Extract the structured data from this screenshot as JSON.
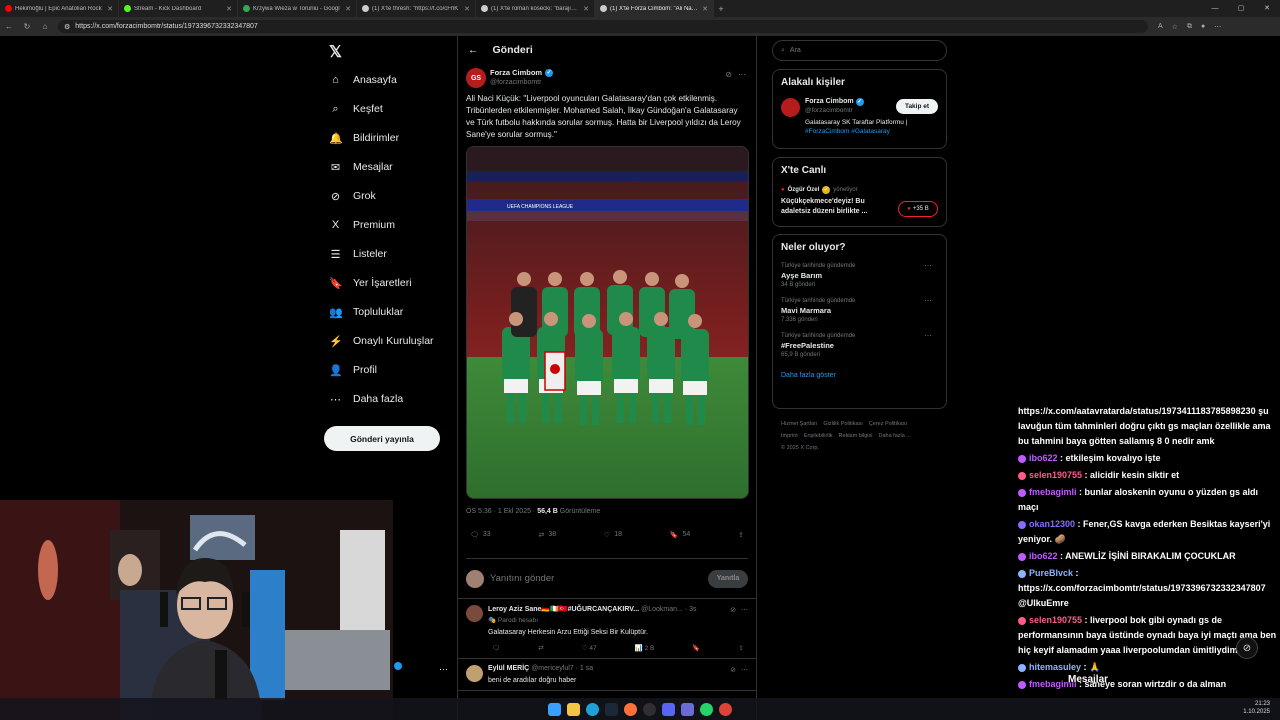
{
  "browser": {
    "tabs": [
      {
        "label": "Hekimoğlu | Epic Anatolian Rock",
        "icon": "youtube-icon",
        "color": "#ff0000"
      },
      {
        "label": "Stream - Kick Dashboard",
        "icon": "kick-icon",
        "color": "#53fc18"
      },
      {
        "label": "Krzywa Wieża w Toruniu - Googl",
        "icon": "maps-icon",
        "color": "#34a853"
      },
      {
        "label": "(1) X'te thresh: \"https://t.co/cFhK",
        "icon": "x-icon",
        "color": "#cccccc"
      },
      {
        "label": "(1) X'te roman kosecki: \"barajın al",
        "icon": "x-icon",
        "color": "#cccccc"
      },
      {
        "label": "(1) X'te Forza Cimbom: \"Ali Naci K",
        "icon": "x-icon",
        "color": "#cccccc"
      }
    ],
    "url": "https://x.com/forzacimbomtr/status/1973396732332347807"
  },
  "nav": {
    "items": [
      {
        "label": "Anasayfa",
        "icon": "home-icon",
        "glyph": "⌂"
      },
      {
        "label": "Keşfet",
        "icon": "search-icon",
        "glyph": "⌕"
      },
      {
        "label": "Bildirimler",
        "icon": "bell-icon",
        "glyph": "🔔"
      },
      {
        "label": "Mesajlar",
        "icon": "mail-icon",
        "glyph": "✉"
      },
      {
        "label": "Grok",
        "icon": "grok-icon",
        "glyph": "⊘"
      },
      {
        "label": "Premium",
        "icon": "x-premium-icon",
        "glyph": "X"
      },
      {
        "label": "Listeler",
        "icon": "list-icon",
        "glyph": "☰"
      },
      {
        "label": "Yer İşaretleri",
        "icon": "bookmark-icon",
        "glyph": "🔖"
      },
      {
        "label": "Topluluklar",
        "icon": "communities-icon",
        "glyph": "👥"
      },
      {
        "label": "Onaylı Kuruluşlar",
        "icon": "lightning-icon",
        "glyph": "⚡"
      },
      {
        "label": "Profil",
        "icon": "profile-icon",
        "glyph": "👤"
      },
      {
        "label": "Daha fazla",
        "icon": "more-circle-icon",
        "glyph": "⋯"
      }
    ],
    "post_button": "Gönderi yayınla",
    "messages_badge": "1"
  },
  "main": {
    "header": "Gönderi",
    "post": {
      "name": "Forza Cimbom",
      "handle": "@forzacimbomtr",
      "text": "Ali Naci Küçük: \"Liverpool oyuncuları Galatasaray'dan çok etkilenmiş. Tribünlerden etkilenmişler. Mohamed Salah, İlkay Gündoğan'a Galatasaray ve Türk futbolu hakkında sorular sormuş. Hatta bir Liverpool yıldızı da Leroy Sane'ye sorular sormuş.\"",
      "media_banner": "UEFA CHAMPIONS LEAGUE",
      "time": "ÖS 5:36 · 1 Ekl 2025 · ",
      "views": "56,4 B",
      "views_label": "Görüntüleme",
      "replies": "33",
      "retweets": "38",
      "likes": "18",
      "bookmarks": "54"
    },
    "reply_placeholder": "Yanıtını gönder",
    "reply_button": "Yanıtla",
    "comments": [
      {
        "name": "Leroy Aziz Sane🇩🇪🇮🇪🇹🇷#UĞURCANÇAKIRV...",
        "handle": "@Lookman...",
        "time": "· 3s",
        "tag": "Parodi hesabı",
        "text": "Galatasaray Herkesin Arzu Ettiği Seksi Bir Kulüptür.",
        "likes": "47",
        "views": "2 B"
      },
      {
        "name": "Eylül MERİÇ",
        "handle": "@mericeylul7",
        "time": "· 1 sa",
        "tag": "",
        "text": "beni de aradılar doğru haber",
        "likes": "",
        "views": ""
      }
    ]
  },
  "right": {
    "search_placeholder": "Ara",
    "related": {
      "title": "Alakalı kişiler",
      "name": "Forza Cimbom",
      "handle": "@forzacimbomtr",
      "bio": "Galatasaray SK Taraftar Platformu | ",
      "bio_tags": "#ForzaCimbom #Galatasaray",
      "follow": "Takip et"
    },
    "live": {
      "title": "X'te Canlı",
      "host": "Özgür Özel",
      "host_suffix": "yönetiyor",
      "text": "Küçükçekmece'deyiz! Bu adaletsiz düzeni birlikte ...",
      "count": "+35 B"
    },
    "trends": {
      "title": "Neler oluyor?",
      "items": [
        {
          "context": "Türkiye tarihinde gündemde",
          "name": "Ayşe Barım",
          "count": "34 B gönderi"
        },
        {
          "context": "Türkiye tarihinde gündemde",
          "name": "Mavi Marmara",
          "count": "7.336 gönderi"
        },
        {
          "context": "Türkiye tarihinde gündemde",
          "name": "#FreePalestine",
          "count": "65,9 B gönderi"
        }
      ],
      "more": "Daha fazla göster"
    },
    "footer": [
      "Hizmet Şartları",
      "Gizlilik Politikası",
      "Çerez Politikası",
      "Imprint",
      "Erişilebilirlik",
      "Reklam bilgisi",
      "Daha fazla ...",
      "© 2025 X Corp."
    ]
  },
  "chat": [
    {
      "user": "",
      "color": "#ffffff",
      "text": "https://x.com/aatavratarda/status/1973411183785898230 şu lavuğun tüm tahminleri doğru çıktı gs maçları özellikle ama bu tahmini baya götten sallamış 8 0 nedir amk"
    },
    {
      "user": "ibo622",
      "color": "#c05cff",
      "text": " : etkileşim kovalıyo işte"
    },
    {
      "user": "selen190755",
      "color": "#ff5c8a",
      "text": " : alicidir kesin siktir et"
    },
    {
      "user": "fmebagimli",
      "color": "#c05cff",
      "text": " : bunlar aloskenin oyunu o yüzden gs aldı maçı"
    },
    {
      "user": "okan12300",
      "color": "#8a6cff",
      "text": " : Fener,GS kavga ederken Besiktas kayseri'yi yeniyor. 🥔"
    },
    {
      "user": "ibo622",
      "color": "#c05cff",
      "text": " : ANEWLİZ İŞİNİ BIRAKALIM ÇOCUKLAR"
    },
    {
      "user": "PureBlvck",
      "color": "#8ab4ff",
      "text": " : https://x.com/forzacimbomtr/status/1973396732332347807 @UlkuEmre"
    },
    {
      "user": "selen190755",
      "color": "#ff5c8a",
      "text": " : liverpool bok gibi oynadı gs de performansının baya üstünde oynadı baya iyi maçtı ama ben hiç keyif alamadım yaaa liverpoolumdan ümitliydim"
    },
    {
      "user": "hitemasuley",
      "color": "#8ab4ff",
      "text": " : 🙏"
    },
    {
      "user": "fmebagimli",
      "color": "#c05cff",
      "text": " : saneye soran wirtzdir o da alman"
    }
  ],
  "overlay": {
    "messages_label": "Mesajlar",
    "clock": "21:23",
    "date": "1.10.2025"
  }
}
